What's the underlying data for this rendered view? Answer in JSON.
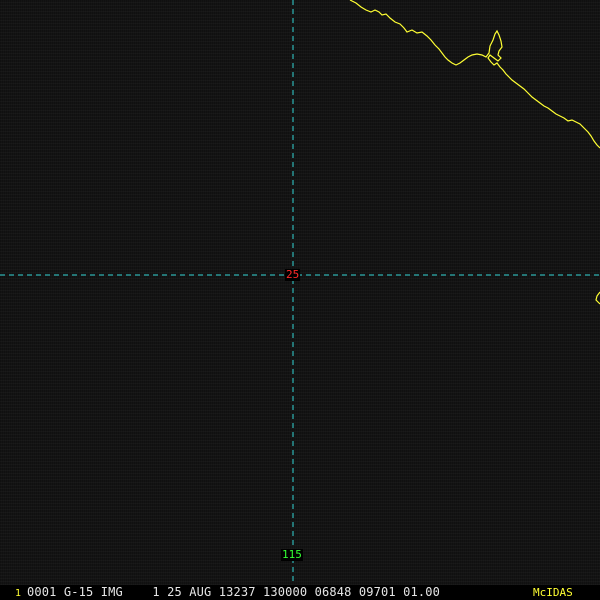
{
  "display": {
    "colors": {
      "background": "#131313",
      "coastline": "#ffff33",
      "graticule": "#33d6d6",
      "latitude_label": "#ff2a2a",
      "longitude_label": "#33ff33",
      "status_text": "#e6e6e6",
      "brand": "#ffff33",
      "frame_number": "#ffff33"
    }
  },
  "graticule": {
    "latitude_label": "25",
    "longitude_label": "115"
  },
  "status_bar": {
    "frame_number": "1",
    "text": "0001 G-15 IMG    1 25 AUG 13237 130000 06848 09701 01.00",
    "brand": "McIDAS"
  }
}
